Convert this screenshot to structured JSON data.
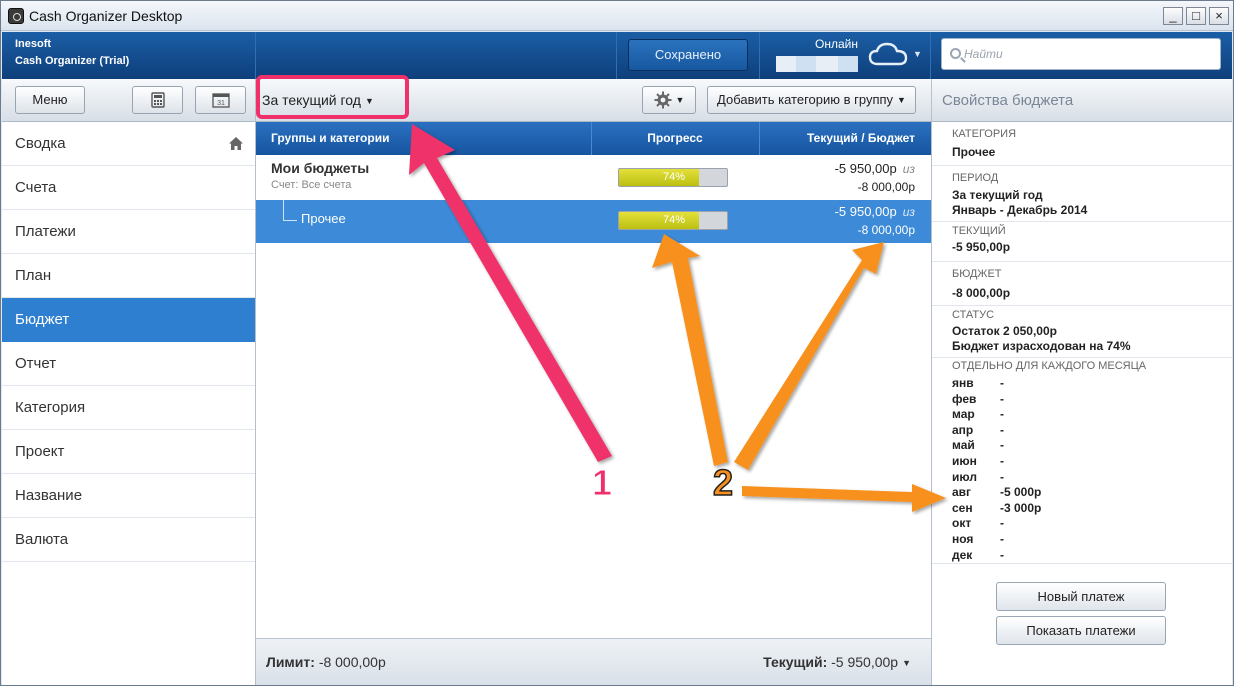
{
  "window": {
    "title": "Cash Organizer Desktop",
    "minimize": "_",
    "maximize": "□",
    "close": "×"
  },
  "header": {
    "company": "Inesoft",
    "product": "Cash Organizer (Trial)",
    "saved_label": "Сохранено",
    "online_label": "Онлайн",
    "search_placeholder": "Найти"
  },
  "toolbar": {
    "menu_label": "Меню",
    "period_label": "За текущий год",
    "add_category_label": "Добавить категорию в группу",
    "props_title": "Свойства бюджета"
  },
  "sidebar": {
    "items": [
      {
        "label": "Сводка"
      },
      {
        "label": "Счета"
      },
      {
        "label": "Платежи"
      },
      {
        "label": "План"
      },
      {
        "label": "Бюджет"
      },
      {
        "label": "Отчет"
      },
      {
        "label": "Категория"
      },
      {
        "label": "Проект"
      },
      {
        "label": "Название"
      },
      {
        "label": "Валюта"
      }
    ],
    "active": "Бюджет"
  },
  "table": {
    "columns": [
      "Группы и категории",
      "Прогресс",
      "Текущий / Бюджет"
    ],
    "rows": [
      {
        "name": "Мои бюджеты",
        "sub": "Счет: Все счета",
        "progress": 74,
        "progress_label": "74%",
        "current": "-5 950,00р",
        "of": "из",
        "budget": "-8 000,00р"
      },
      {
        "name": "Прочее",
        "progress": 74,
        "progress_label": "74%",
        "current": "-5 950,00р",
        "of": "из",
        "budget": "-8 000,00р"
      }
    ]
  },
  "footer": {
    "limit_label": "Лимит:",
    "limit_value": "-8 000,00р",
    "current_label": "Текущий:",
    "current_value": "-5 950,00р"
  },
  "properties": {
    "category_key": "КАТЕГОРИЯ",
    "category_value": "Прочее",
    "period_key": "ПЕРИОД",
    "period_value_1": "За текущий год",
    "period_value_2": "Январь - Декабрь 2014",
    "current_key": "ТЕКУЩИЙ",
    "current_value": "-5 950,00р",
    "budget_key": "БЮДЖЕТ",
    "budget_value": "-8 000,00р",
    "status_key": "СТАТУС",
    "status_value_1": "Остаток 2 050,00р",
    "status_value_2": "Бюджет израсходован на 74%",
    "monthly_key": "ОТДЕЛЬНО ДЛЯ КАЖДОГО МЕСЯЦА",
    "months": [
      {
        "m": "янв",
        "v": "-"
      },
      {
        "m": "фев",
        "v": "-"
      },
      {
        "m": "мар",
        "v": "-"
      },
      {
        "m": "апр",
        "v": "-"
      },
      {
        "m": "май",
        "v": "-"
      },
      {
        "m": "июн",
        "v": "-"
      },
      {
        "m": "июл",
        "v": "-"
      },
      {
        "m": "авг",
        "v": "-5 000р"
      },
      {
        "m": "сен",
        "v": "-3 000р"
      },
      {
        "m": "окт",
        "v": "-"
      },
      {
        "m": "ноя",
        "v": "-"
      },
      {
        "m": "дек",
        "v": "-"
      }
    ],
    "new_payment_label": "Новый платеж",
    "show_payments_label": "Показать платежи"
  },
  "annotations": {
    "label_1": "1",
    "label_2": "2"
  },
  "colors": {
    "accent": "#2f7fd0",
    "header": "#1655a0",
    "highlight_pink": "#f0306a",
    "arrow_orange": "#f7901e",
    "progress_fill": "#c8ca1c"
  },
  "icons": [
    "calculator-icon",
    "calendar-icon",
    "gear-icon",
    "cloud-icon",
    "search-icon",
    "home-icon"
  ]
}
